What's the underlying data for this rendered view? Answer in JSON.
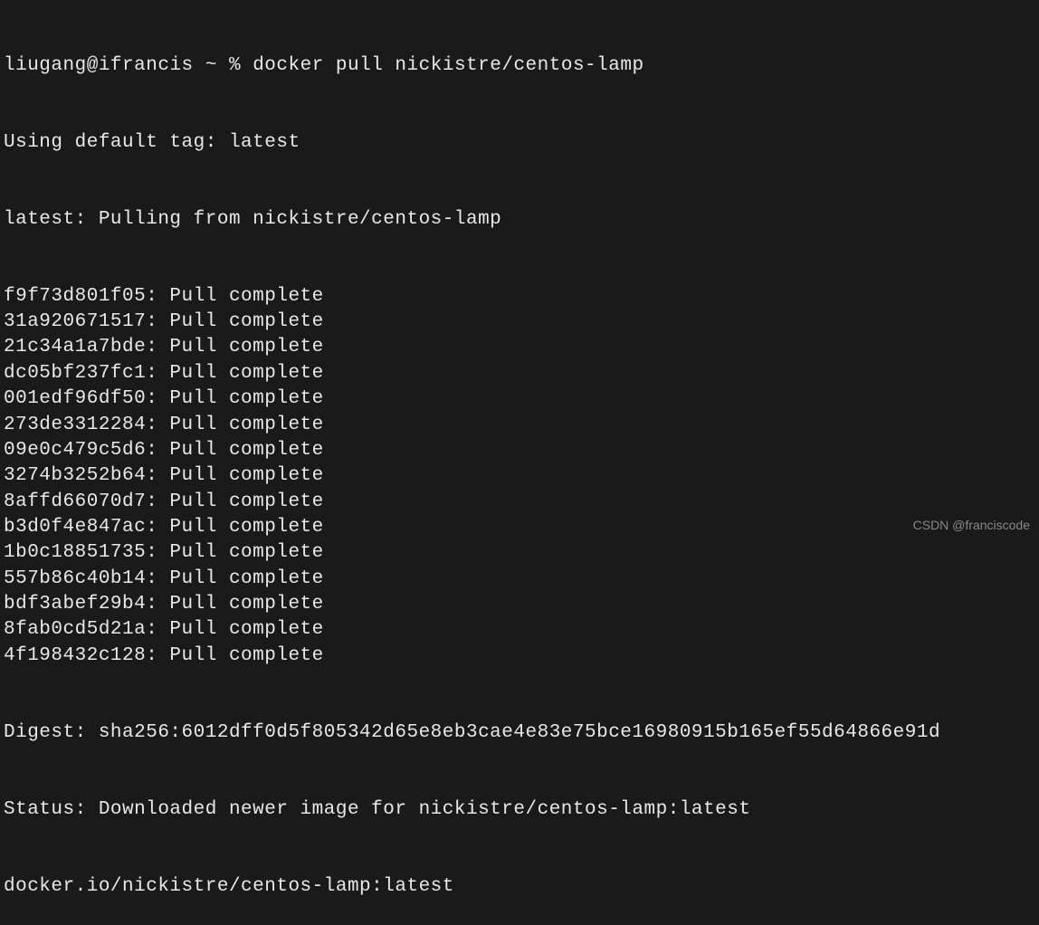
{
  "prompt": {
    "user": "liugang",
    "host": "ifrancis",
    "path": "~",
    "symbol": "%",
    "command": "docker pull nickistre/centos-lamp"
  },
  "output": {
    "tag_line": "Using default tag: latest",
    "pulling_line": "latest: Pulling from nickistre/centos-lamp",
    "layers": [
      {
        "hash": "f9f73d801f05",
        "status": "Pull complete"
      },
      {
        "hash": "31a920671517",
        "status": "Pull complete"
      },
      {
        "hash": "21c34a1a7bde",
        "status": "Pull complete"
      },
      {
        "hash": "dc05bf237fc1",
        "status": "Pull complete"
      },
      {
        "hash": "001edf96df50",
        "status": "Pull complete"
      },
      {
        "hash": "273de3312284",
        "status": "Pull complete"
      },
      {
        "hash": "09e0c479c5d6",
        "status": "Pull complete"
      },
      {
        "hash": "3274b3252b64",
        "status": "Pull complete"
      },
      {
        "hash": "8affd66070d7",
        "status": "Pull complete"
      },
      {
        "hash": "b3d0f4e847ac",
        "status": "Pull complete"
      },
      {
        "hash": "1b0c18851735",
        "status": "Pull complete"
      },
      {
        "hash": "557b86c40b14",
        "status": "Pull complete"
      },
      {
        "hash": "bdf3abef29b4",
        "status": "Pull complete"
      },
      {
        "hash": "8fab0cd5d21a",
        "status": "Pull complete"
      },
      {
        "hash": "4f198432c128",
        "status": "Pull complete"
      }
    ],
    "digest": "Digest: sha256:6012dff0d5f805342d65e8eb3cae4e83e75bce16980915b165ef55d64866e91d",
    "status": "Status: Downloaded newer image for nickistre/centos-lamp:latest",
    "image_ref": "docker.io/nickistre/centos-lamp:latest"
  },
  "watermark": "CSDN @franciscode"
}
